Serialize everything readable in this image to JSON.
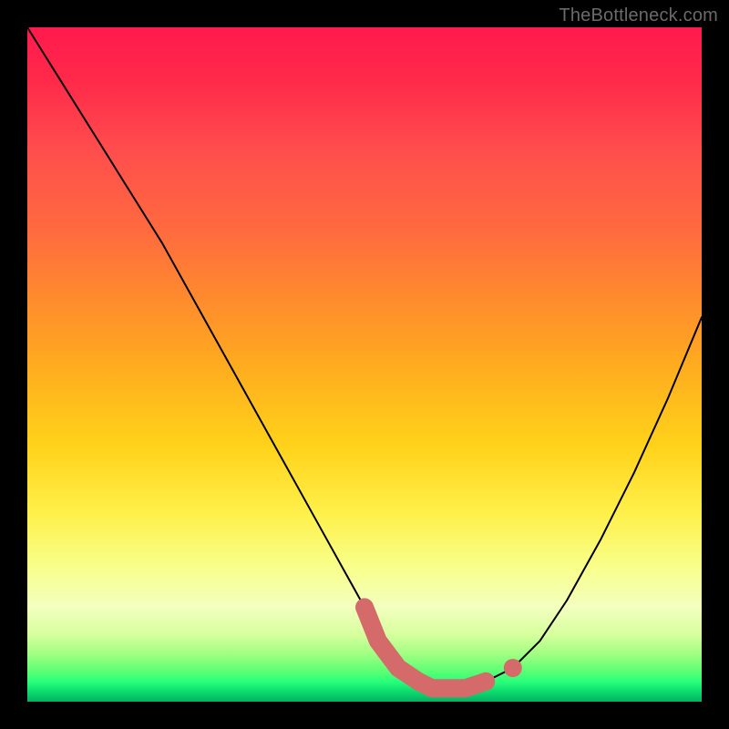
{
  "watermark": "TheBottleneck.com",
  "chart_data": {
    "type": "line",
    "title": "",
    "xlabel": "",
    "ylabel": "",
    "xlim": [
      0,
      100
    ],
    "ylim": [
      0,
      100
    ],
    "grid": false,
    "legend": false,
    "series": [
      {
        "name": "bottleneck-curve",
        "x": [
          0,
          5,
          10,
          15,
          20,
          25,
          30,
          35,
          40,
          45,
          50,
          52,
          55,
          58,
          60,
          62,
          65,
          68,
          72,
          76,
          80,
          85,
          90,
          95,
          100
        ],
        "y": [
          100,
          92,
          84,
          76,
          68,
          59,
          50,
          41,
          32,
          23,
          14,
          9,
          5,
          3,
          2,
          2,
          2,
          3,
          5,
          9,
          15,
          24,
          34,
          45,
          57
        ]
      }
    ],
    "highlight": {
      "name": "optimal-range",
      "x": [
        50,
        52,
        55,
        58,
        60,
        62,
        65,
        68
      ],
      "y": [
        14,
        9,
        5,
        3,
        2,
        2,
        2,
        3
      ]
    },
    "highlight_marker": {
      "x": 72,
      "y": 5
    },
    "background_gradient": {
      "orientation": "vertical",
      "stops": [
        {
          "pos": 0.0,
          "color": "#ff1a4d"
        },
        {
          "pos": 0.4,
          "color": "#ff8a2e"
        },
        {
          "pos": 0.72,
          "color": "#fff04a"
        },
        {
          "pos": 0.9,
          "color": "#d7ff9e"
        },
        {
          "pos": 1.0,
          "color": "#04b060"
        }
      ]
    }
  }
}
